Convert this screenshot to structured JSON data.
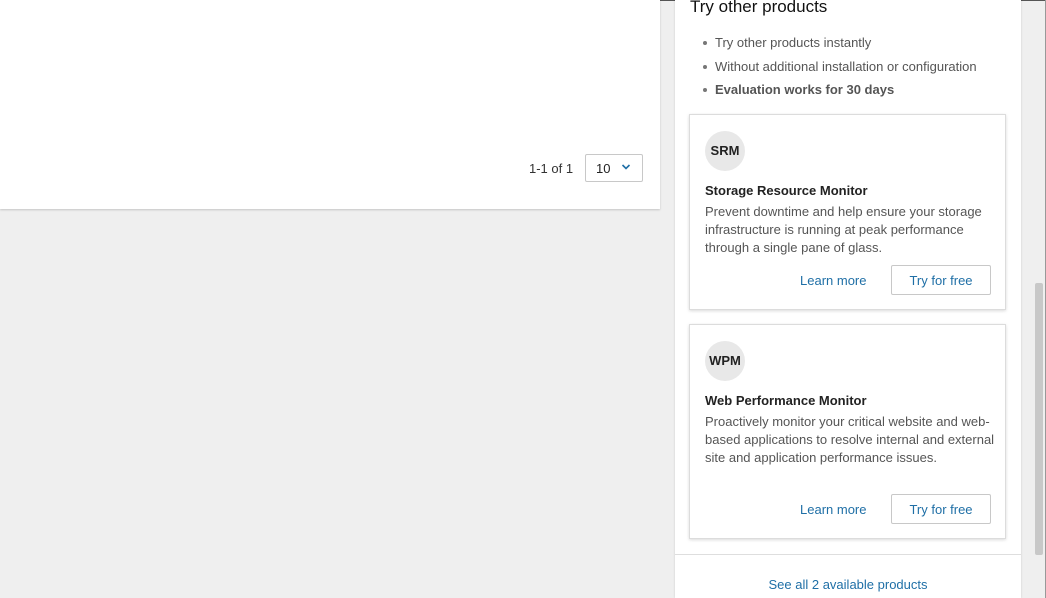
{
  "main": {
    "pagination": {
      "range_text": "1-1 of 1",
      "page_size": "10"
    }
  },
  "sidebar": {
    "title": "Try other products",
    "bullets": [
      "Try other products instantly",
      "Without additional installation or configuration",
      "Evaluation works for 30 days"
    ],
    "products": [
      {
        "abbr": "SRM",
        "name": "Storage Resource Monitor",
        "description": "Prevent downtime and help ensure your storage infrastructure is running at peak performance through a single pane of glass.",
        "learn_more": "Learn more",
        "try_label": "Try for free"
      },
      {
        "abbr": "WPM",
        "name": "Web Performance Monitor",
        "description": "Proactively monitor your critical website and web-based applications to resolve internal and external site and application performance issues.",
        "learn_more": "Learn more",
        "try_label": "Try for free"
      }
    ],
    "see_all": "See all 2 available products"
  },
  "colors": {
    "link": "#1f6fa6",
    "background": "#efefef"
  },
  "icons": {
    "page_size_dropdown": "chevron-down-icon"
  }
}
